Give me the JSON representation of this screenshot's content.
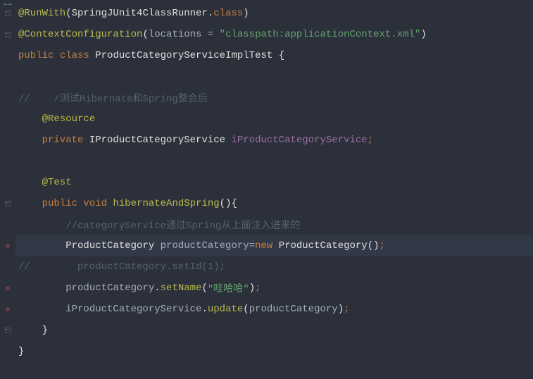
{
  "code": {
    "l1_annotation": "@RunWith",
    "l1_paren_o": "(",
    "l1_arg": "SpringJUnit4ClassRunner",
    "l1_dot": ".",
    "l1_class": "class",
    "l1_paren_c": ")",
    "l2_annotation": "@ContextConfiguration",
    "l2_paren_o": "(",
    "l2_key": "locations ",
    "l2_eq": "= ",
    "l2_str": "\"classpath:applicationContext.xml\"",
    "l2_paren_c": ")",
    "l3_public": "public ",
    "l3_class": "class ",
    "l3_name": "ProductCategoryServiceImplTest ",
    "l3_brace": "{",
    "l5_comment": "//    /测试Hibernate和Spring整合后",
    "l6_annotation": "    @Resource",
    "l7_private": "    private ",
    "l7_type": "IProductCategoryService ",
    "l7_field": "iProductCategoryService",
    "l7_semi": ";",
    "l9_annotation": "    @Test",
    "l10_public": "    public ",
    "l10_void": "void ",
    "l10_method": "hibernateAndSpring",
    "l10_parens": "()",
    "l10_brace": "{",
    "l11_comment": "        //categoryService通过Spring从上面注入进来的",
    "l12_indent": "        ",
    "l12_type1": "ProductCategory ",
    "l12_var": "productCategory",
    "l12_eq": "=",
    "l12_new": "new ",
    "l12_type2": "ProductCategory",
    "l12_parens": "()",
    "l12_semi": ";",
    "l13_comment": "//        productCategory.setId(1);",
    "l14_indent": "        ",
    "l14_var": "productCategory",
    "l14_dot": ".",
    "l14_method": "setName",
    "l14_po": "(",
    "l14_str": "\"哇哈哈\"",
    "l14_pc": ")",
    "l14_semi": ";",
    "l15_indent": "        ",
    "l15_var": "iProductCategoryService",
    "l15_dot": ".",
    "l15_method": "update",
    "l15_po": "(",
    "l15_arg": "productCategory",
    "l15_pc": ")",
    "l15_semi": ";",
    "l16_brace": "    }",
    "l17_brace": "}"
  }
}
